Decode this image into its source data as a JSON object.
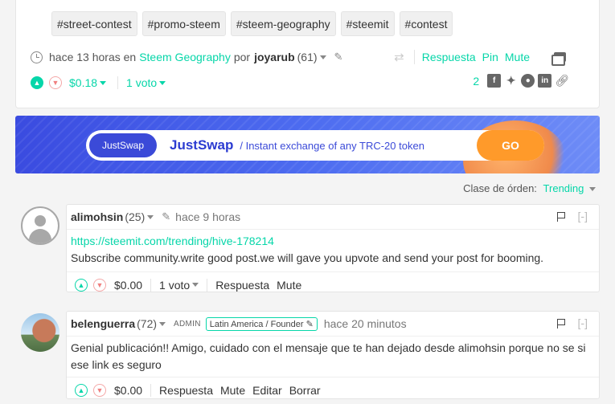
{
  "post": {
    "tags": [
      "#street-contest",
      "#promo-steem",
      "#steem-geography",
      "#steemit",
      "#contest"
    ],
    "meta": {
      "time": "hace 13 horas en",
      "community": "Steem Geography",
      "by": "por",
      "author": "joyarub",
      "reputation": "(61)"
    },
    "actions": {
      "reply": "Respuesta",
      "pin": "Pin",
      "mute": "Mute"
    },
    "payout": "$0.18",
    "votes": "1 voto",
    "share_count": "2"
  },
  "banner": {
    "logo": "JustSwap",
    "title": "JustSwap",
    "subtitle": "/ Instant exchange of any TRC-20 token",
    "cta": "GO"
  },
  "sort": {
    "label": "Clase de órden:",
    "value": "Trending"
  },
  "comments": [
    {
      "author": "alimohsin",
      "reputation": "(25)",
      "time": "hace 9 horas",
      "link": "https://steemit.com/trending/hive-178214",
      "body": "Subscribe community.write good post.we will gave you upvote and send your post for booming.",
      "payout": "$0.00",
      "votes": "1 voto",
      "actions": [
        "Respuesta",
        "Mute"
      ],
      "collapse": "[-]"
    },
    {
      "author": "belenguerra",
      "reputation": "(72)",
      "role": "ADMIN",
      "badge": "Latin America / Founder",
      "time": "hace 20 minutos",
      "body": "Genial publicación!! Amigo, cuidado con el mensaje que te han dejado desde alimohsin porque no se si ese link es seguro",
      "payout": "$0.00",
      "actions": [
        "Respuesta",
        "Mute",
        "Editar",
        "Borrar"
      ],
      "collapse": "[-]"
    }
  ],
  "colors": {
    "accent": "#06d6a9",
    "banner": "#3b4ad8",
    "cta": "#ff9a2a"
  }
}
